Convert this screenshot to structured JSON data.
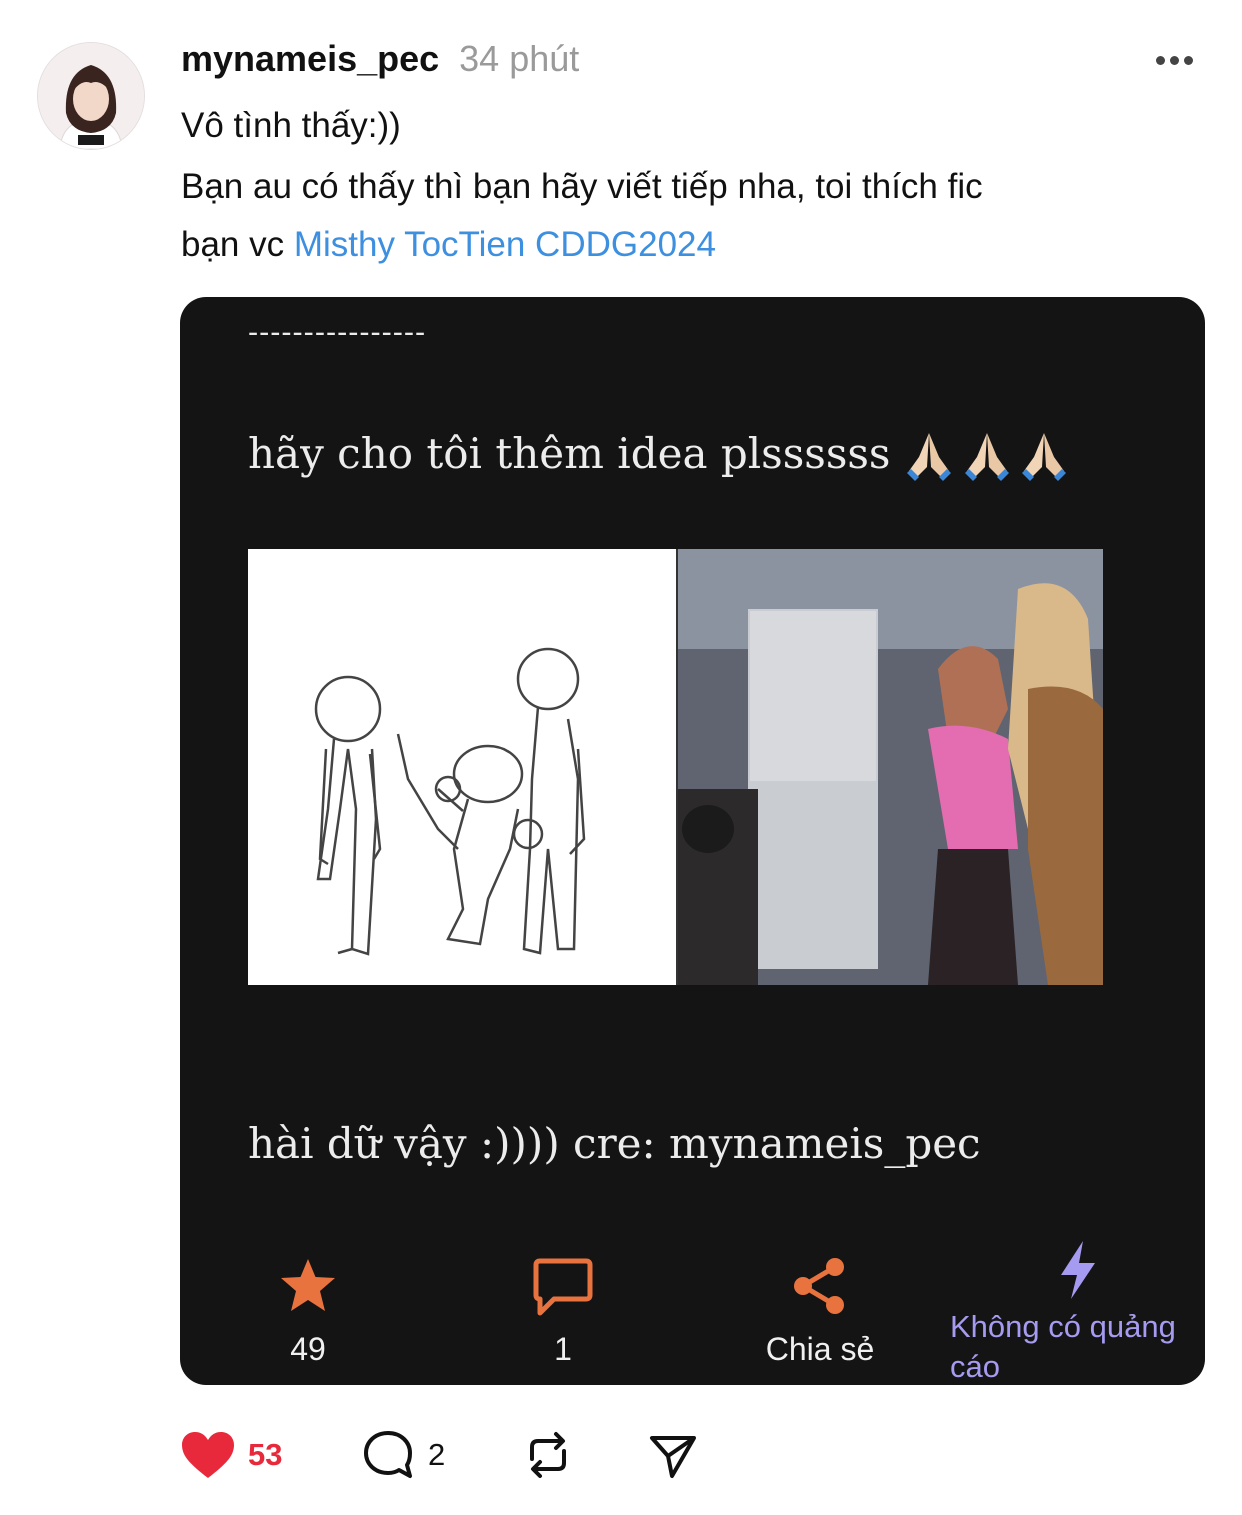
{
  "post": {
    "username": "mynameis_pec",
    "time": "34 phút",
    "line1": "Vô tình thấy:))",
    "line2": "Bạn au có thấy thì bạn hãy viết tiếp nha, toi thích fic",
    "line3_prefix": "bạn vc",
    "tags": "Misthy TocTien CDDG2024"
  },
  "embedded": {
    "dashes": "----------------",
    "caption1": "hãy cho tôi thêm idea plssssss",
    "caption2": "hài dữ vậy :)))) cre: mynameis_pec",
    "actions": {
      "star_count": "49",
      "comment_count": "1",
      "share_label": "Chia sẻ",
      "noads_label": "Không có quảng cáo"
    }
  },
  "footer": {
    "likes": "53",
    "replies": "2"
  },
  "colors": {
    "tag_blue": "#3d8fe0",
    "like_red": "#e8293b",
    "embed_orange": "#e8733e",
    "embed_purple": "#a59bf0"
  }
}
